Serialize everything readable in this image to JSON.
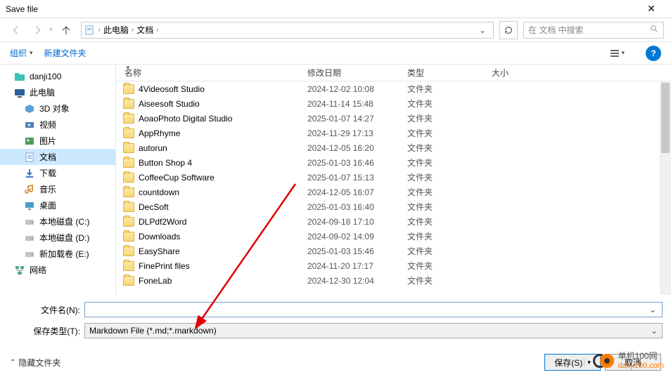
{
  "window": {
    "title": "Save file"
  },
  "nav": {
    "breadcrumbs": [
      "此电脑",
      "文档"
    ],
    "search_placeholder": "在 文档 中搜索"
  },
  "toolbar": {
    "organize": "组织",
    "newfolder": "新建文件夹"
  },
  "sidebar": {
    "items": [
      {
        "label": "danji100",
        "icon": "folder-teal",
        "level": 1
      },
      {
        "label": "此电脑",
        "icon": "pc",
        "level": 1
      },
      {
        "label": "3D 对象",
        "icon": "3d",
        "level": 2
      },
      {
        "label": "视频",
        "icon": "video",
        "level": 2
      },
      {
        "label": "图片",
        "icon": "pictures",
        "level": 2
      },
      {
        "label": "文档",
        "icon": "documents",
        "level": 2,
        "selected": true
      },
      {
        "label": "下载",
        "icon": "downloads",
        "level": 2
      },
      {
        "label": "音乐",
        "icon": "music",
        "level": 2
      },
      {
        "label": "桌面",
        "icon": "desktop",
        "level": 2
      },
      {
        "label": "本地磁盘 (C:)",
        "icon": "drive",
        "level": 2
      },
      {
        "label": "本地磁盘 (D:)",
        "icon": "drive",
        "level": 2
      },
      {
        "label": "新加载卷 (E:)",
        "icon": "drive",
        "level": 2
      },
      {
        "label": "网络",
        "icon": "network",
        "level": 1
      }
    ]
  },
  "columns": {
    "name": "名称",
    "modified": "修改日期",
    "type": "类型",
    "size": "大小"
  },
  "files": [
    {
      "name": "4Videosoft Studio",
      "date": "2024-12-02 10:08",
      "type": "文件夹"
    },
    {
      "name": "Aiseesoft Studio",
      "date": "2024-11-14 15:48",
      "type": "文件夹"
    },
    {
      "name": "AoaoPhoto Digital Studio",
      "date": "2025-01-07 14:27",
      "type": "文件夹"
    },
    {
      "name": "AppRhyme",
      "date": "2024-11-29 17:13",
      "type": "文件夹"
    },
    {
      "name": "autorun",
      "date": "2024-12-05 16:20",
      "type": "文件夹"
    },
    {
      "name": "Button Shop 4",
      "date": "2025-01-03 16:46",
      "type": "文件夹"
    },
    {
      "name": "CoffeeCup Software",
      "date": "2025-01-07 15:13",
      "type": "文件夹"
    },
    {
      "name": "countdown",
      "date": "2024-12-05 16:07",
      "type": "文件夹"
    },
    {
      "name": "DecSoft",
      "date": "2025-01-03 16:40",
      "type": "文件夹"
    },
    {
      "name": "DLPdf2Word",
      "date": "2024-09-18 17:10",
      "type": "文件夹"
    },
    {
      "name": "Downloads",
      "date": "2024-09-02 14:09",
      "type": "文件夹"
    },
    {
      "name": "EasyShare",
      "date": "2025-01-03 15:46",
      "type": "文件夹"
    },
    {
      "name": "FinePrint files",
      "date": "2024-11-20 17:17",
      "type": "文件夹"
    },
    {
      "name": "FoneLab",
      "date": "2024-12-30 12:04",
      "type": "文件夹"
    }
  ],
  "form": {
    "filename_label": "文件名(N):",
    "filename_value": "",
    "type_label": "保存类型(T):",
    "type_value": "Markdown File (*.md;*.markdown)"
  },
  "footer": {
    "hide": "隐藏文件夹",
    "save": "保存(S)",
    "cancel": "取消"
  },
  "watermark": {
    "line1": "单机100网",
    "line2": "danji100.com"
  }
}
